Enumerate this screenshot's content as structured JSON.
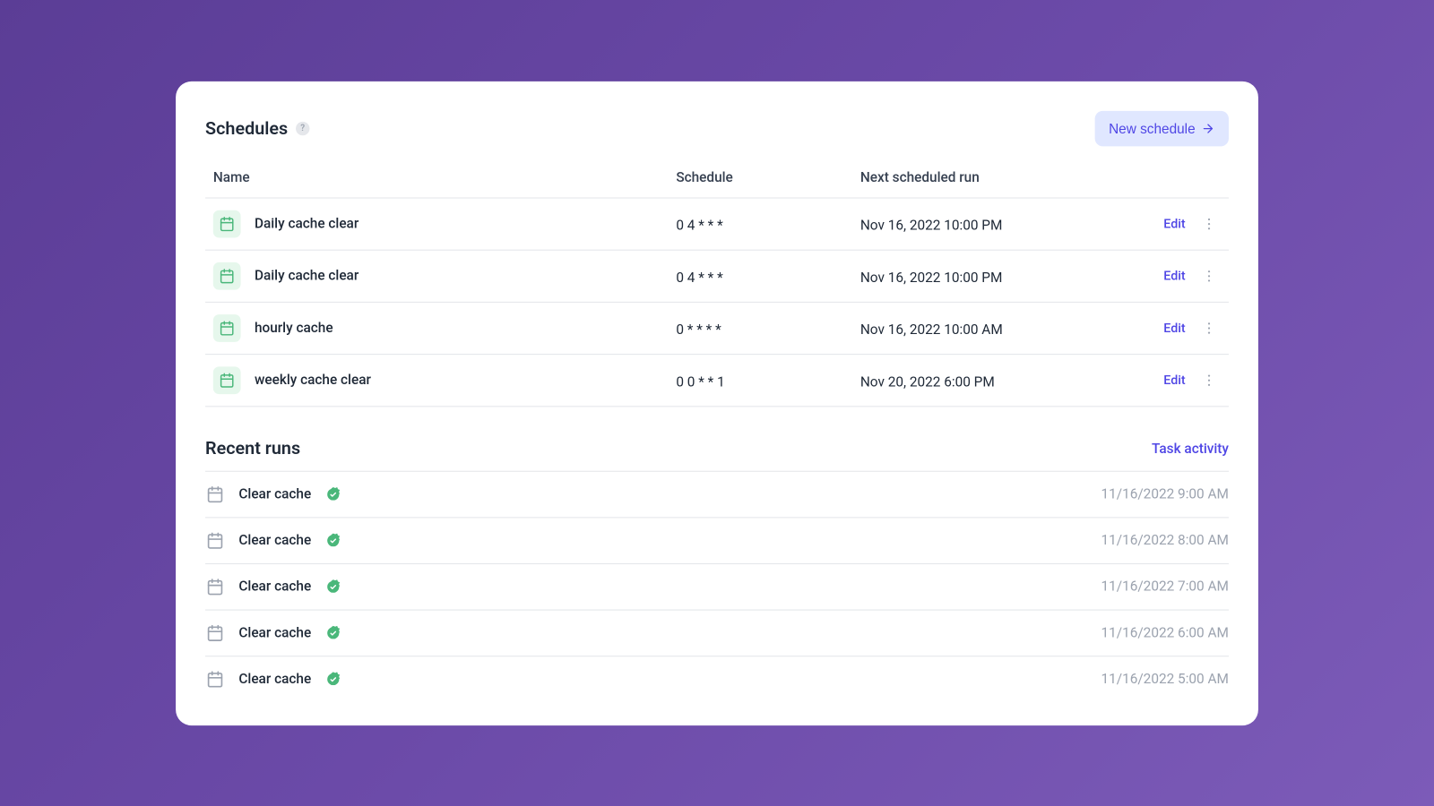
{
  "schedules_title": "Schedules",
  "new_schedule_label": "New schedule",
  "columns": {
    "name": "Name",
    "schedule": "Schedule",
    "next": "Next scheduled run"
  },
  "edit_label": "Edit",
  "schedules": [
    {
      "name": "Daily cache clear",
      "cron": "0 4 * * *",
      "next": "Nov 16, 2022 10:00 PM"
    },
    {
      "name": "Daily cache clear",
      "cron": "0 4 * * *",
      "next": "Nov 16, 2022 10:00 PM"
    },
    {
      "name": "hourly cache",
      "cron": "0 * * * *",
      "next": "Nov 16, 2022 10:00 AM"
    },
    {
      "name": "weekly cache clear",
      "cron": "0 0 * * 1",
      "next": "Nov 20, 2022 6:00 PM"
    }
  ],
  "recent_title": "Recent runs",
  "task_activity_label": "Task activity",
  "runs": [
    {
      "name": "Clear cache",
      "time": "11/16/2022 9:00 AM"
    },
    {
      "name": "Clear cache",
      "time": "11/16/2022 8:00 AM"
    },
    {
      "name": "Clear cache",
      "time": "11/16/2022 7:00 AM"
    },
    {
      "name": "Clear cache",
      "time": "11/16/2022 6:00 AM"
    },
    {
      "name": "Clear cache",
      "time": "11/16/2022 5:00 AM"
    }
  ]
}
